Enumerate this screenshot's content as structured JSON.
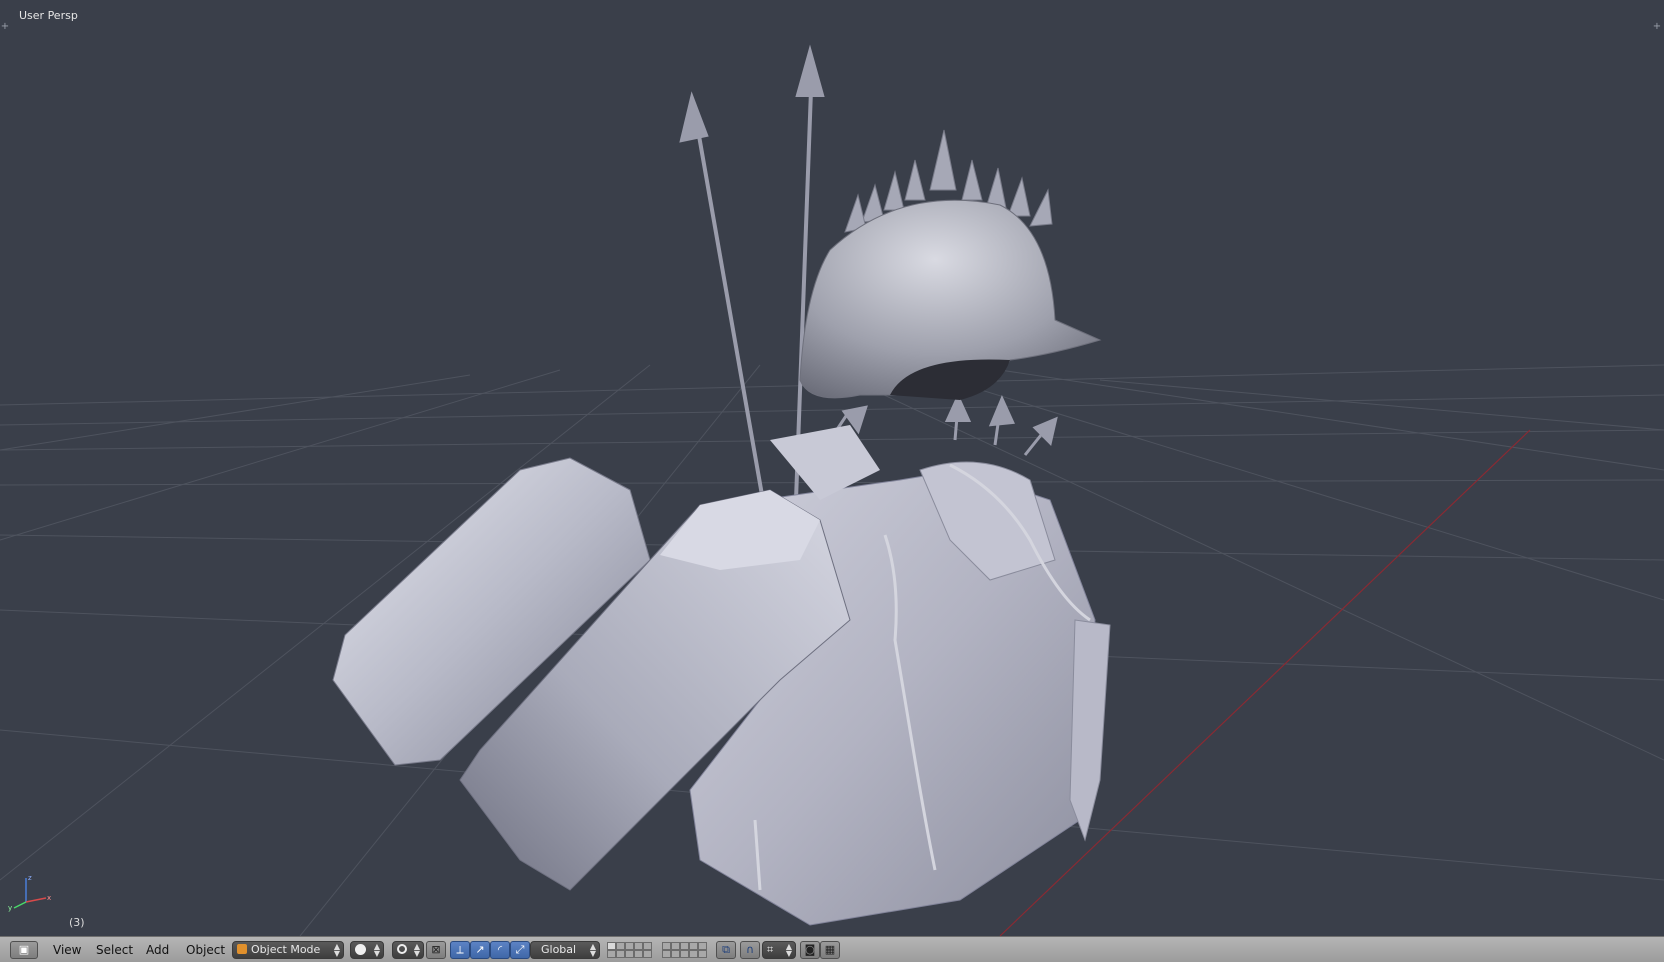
{
  "viewport": {
    "view_label": "User Persp",
    "frame_label": "(3)",
    "grid_color": "#4d525c",
    "background_color": "#3a3f4a",
    "x_axis_line_color": "#8a2a33"
  },
  "header": {
    "menu": {
      "view": "View",
      "select": "Select",
      "add": "Add",
      "object": "Object"
    },
    "mode_select": {
      "value": "Object Mode",
      "icon": "cube-icon"
    },
    "shading_icon": "solid-sphere-icon",
    "pivot_icon": "pivot-point-icon",
    "manipulator_icons": [
      "manipulator-toggle-icon",
      "translate-arrow-icon",
      "rotate-arc-icon",
      "scale-icon"
    ],
    "orientation_select": {
      "value": "Global"
    },
    "layer_icons": [
      "layers-group-1",
      "layers-group-2"
    ],
    "extra_icons": [
      "lock-camera-icon",
      "snap-magnet-icon",
      "snap-element-icon",
      "render-camera-icon",
      "render-animation-icon"
    ],
    "accent_color": "#4a72b8"
  }
}
